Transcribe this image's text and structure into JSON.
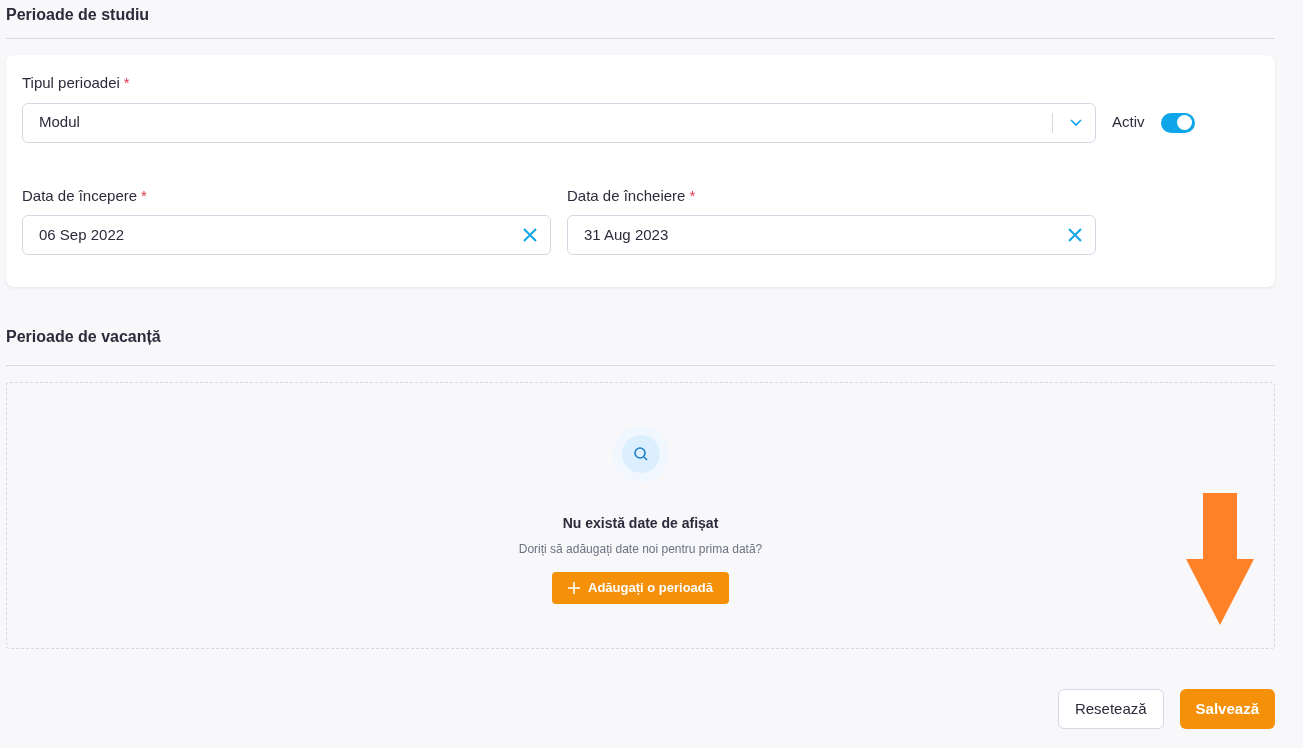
{
  "study_section": {
    "title": "Perioade de studiu"
  },
  "period_type": {
    "label": "Tipul perioadei",
    "required_mark": "*",
    "value": "Modul"
  },
  "active_toggle": {
    "label": "Activ",
    "on": true
  },
  "dates": [
    {
      "label": "Data de începere",
      "required_mark": "*",
      "value": "06 Sep 2022"
    },
    {
      "label": "Data de încheiere",
      "required_mark": "*",
      "value": "31 Aug 2023"
    }
  ],
  "vacation_section": {
    "title": "Perioade de vacanță",
    "empty_title": "Nu există date de afișat",
    "empty_text": "Doriți să adăugați date noi pentru prima dată?",
    "add_button": "Adăugați o perioadă"
  },
  "buttons": [
    {
      "label": "Resetează",
      "kind": "secondary"
    },
    {
      "label": "Salvează",
      "kind": "primary"
    }
  ]
}
